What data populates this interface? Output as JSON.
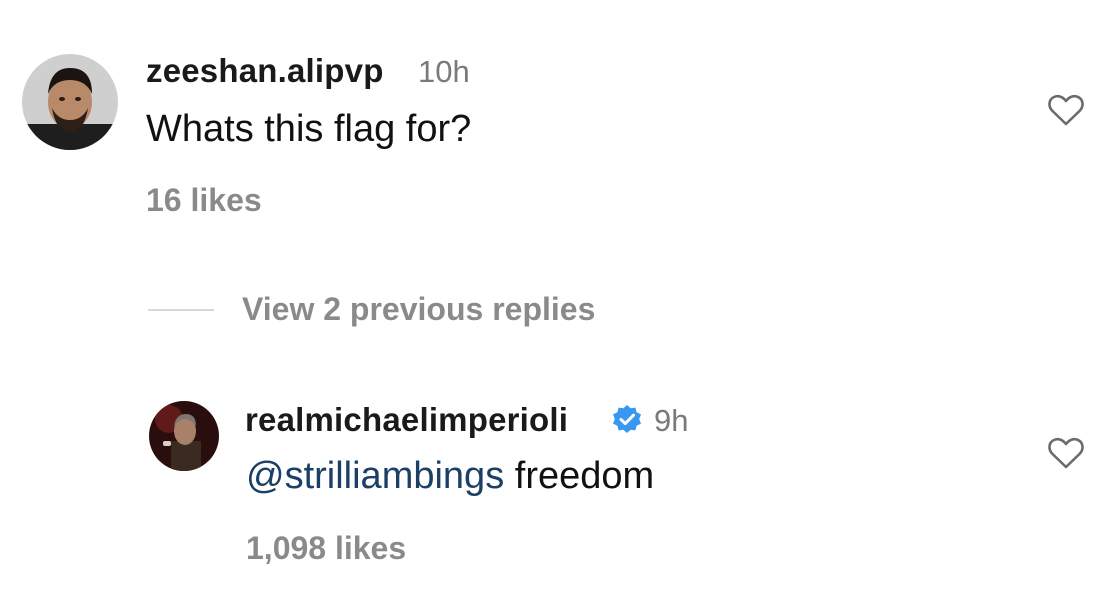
{
  "comment": {
    "username": "zeeshan.alipvp",
    "time": "10h",
    "text": "Whats this flag for?",
    "likes": "16 likes"
  },
  "replies_toggle": {
    "label": "View 2 previous replies"
  },
  "reply": {
    "username": "realmichaelimperioli",
    "verified": true,
    "time": "9h",
    "mention": "@strilliambings",
    "text": " freedom",
    "likes": "1,098 likes"
  },
  "colors": {
    "mention": "#1c3f66",
    "verified_badge": "#3897f0",
    "secondary_text": "#8a8a8a"
  },
  "icons": {
    "like": "heart-outline-icon",
    "verified": "verified-badge-icon"
  }
}
